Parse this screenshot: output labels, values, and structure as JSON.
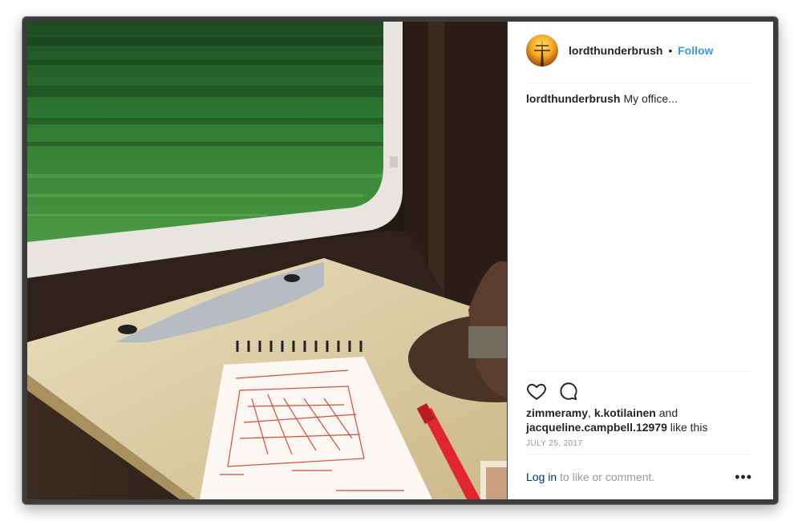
{
  "post": {
    "username": "lordthunderbrush",
    "dot": "•",
    "follow_label": "Follow",
    "caption_user": "lordthunderbrush",
    "caption_text": "My office...",
    "likes": {
      "user1": "zimmeramy",
      "sep1": ", ",
      "user2": "k.kotilainen",
      "and": " and",
      "user3": "jacqueline.campbell.12979",
      "suffix": " like this"
    },
    "date": "JULY 25, 2017",
    "login_label": "Log in",
    "comment_prompt": " to like or comment.",
    "more_label": "•••"
  },
  "icons": {
    "like": "heart-icon",
    "comment": "comment-icon",
    "more": "more-options-icon"
  },
  "colors": {
    "accent": "#3897f0",
    "login_link": "#003569",
    "text": "#262626",
    "muted": "#999999",
    "window_frame": "#3c3c3c"
  }
}
